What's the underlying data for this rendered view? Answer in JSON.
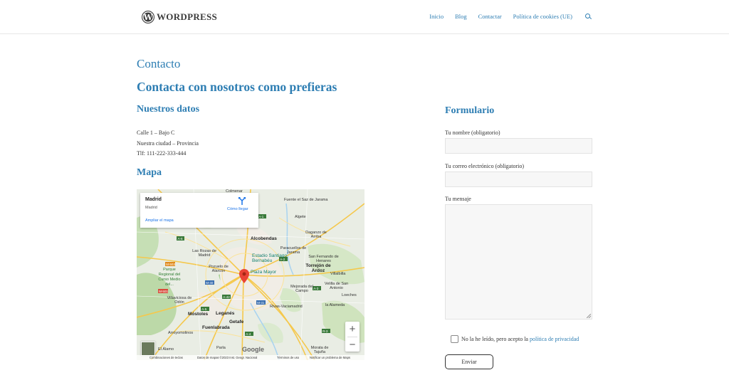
{
  "header": {
    "logo_letter": "W",
    "logo_text": "WordPress",
    "nav": [
      "Inicio",
      "Blog",
      "Contactar",
      "Política de cookies (UE)"
    ],
    "search_icon": "search-icon"
  },
  "page": {
    "title": "Contacto",
    "heading": "Contacta con nosotros como prefieras"
  },
  "datos": {
    "heading": "Nuestros datos",
    "lines": [
      "Calle 1 – Bajo C",
      "Nuestra ciudad – Provincia",
      "Tlf: 111-222-333-444"
    ]
  },
  "mapa": {
    "heading": "Mapa",
    "card": {
      "place": "Madrid",
      "sub": "Madrid",
      "enlarge": "Ampliar el mapa",
      "directions": "Cómo llegar"
    },
    "zoom_in": "+",
    "zoom_out": "−",
    "google": "Google",
    "attribution": [
      "Combinaciones de teclas",
      "Datos de mapas ©2023 Inst. Geogr. Nacional",
      "Términos de uso",
      "Notificar un problema de Maps"
    ],
    "labels": {
      "alcobendas": "Alcobendas",
      "algete": "Algete",
      "daganzo": "Daganzo de Arriba",
      "paracuellos": "Paracuellos de Jarama",
      "san_fernando": "San Fernando de Henares",
      "torrejon": "Torrejón de Ardoz",
      "las_rozas": "Las Rozas de Madrid",
      "pozuelo": "Pozuelo de Alarcón",
      "estadio": "Estadio Santiago Bernabéu",
      "plaza": "Plaza Mayor",
      "mejorada": "Mejorada del Campo",
      "velilla": "Velilla de San Antonio",
      "mostoles": "Móstoles",
      "leganes": "Leganés",
      "getafe": "Getafe",
      "fuenlabrada": "Fuenlabrada",
      "parque": "Parque Regional del Curso Medio del...",
      "villaviciosa": "Villaviciosa de Odón",
      "arroyomolinos": "Arroyomolinos",
      "rivas": "Rivas-Vaciamadrid",
      "alamo": "El Álamo",
      "parla": "Parla",
      "fuente": "Fuente el Saz de Jarama",
      "colmenar": "Colmenar",
      "alameda": "la Alameda",
      "villalbilla": "Villalbilla",
      "loeches": "Loeches",
      "morata": "Morata de Tajuña"
    }
  },
  "form": {
    "heading": "Formulario",
    "name_label": "Tu nombre (obligatorio)",
    "email_label": "Tu correo electrónico (obligatorio)",
    "message_label": "Tu mensaje",
    "name_value": "",
    "email_value": "",
    "message_value": "",
    "consent_text": "No la he leído, pero acepto la ",
    "consent_link": "política de privacidad",
    "submit": "Enviar"
  }
}
